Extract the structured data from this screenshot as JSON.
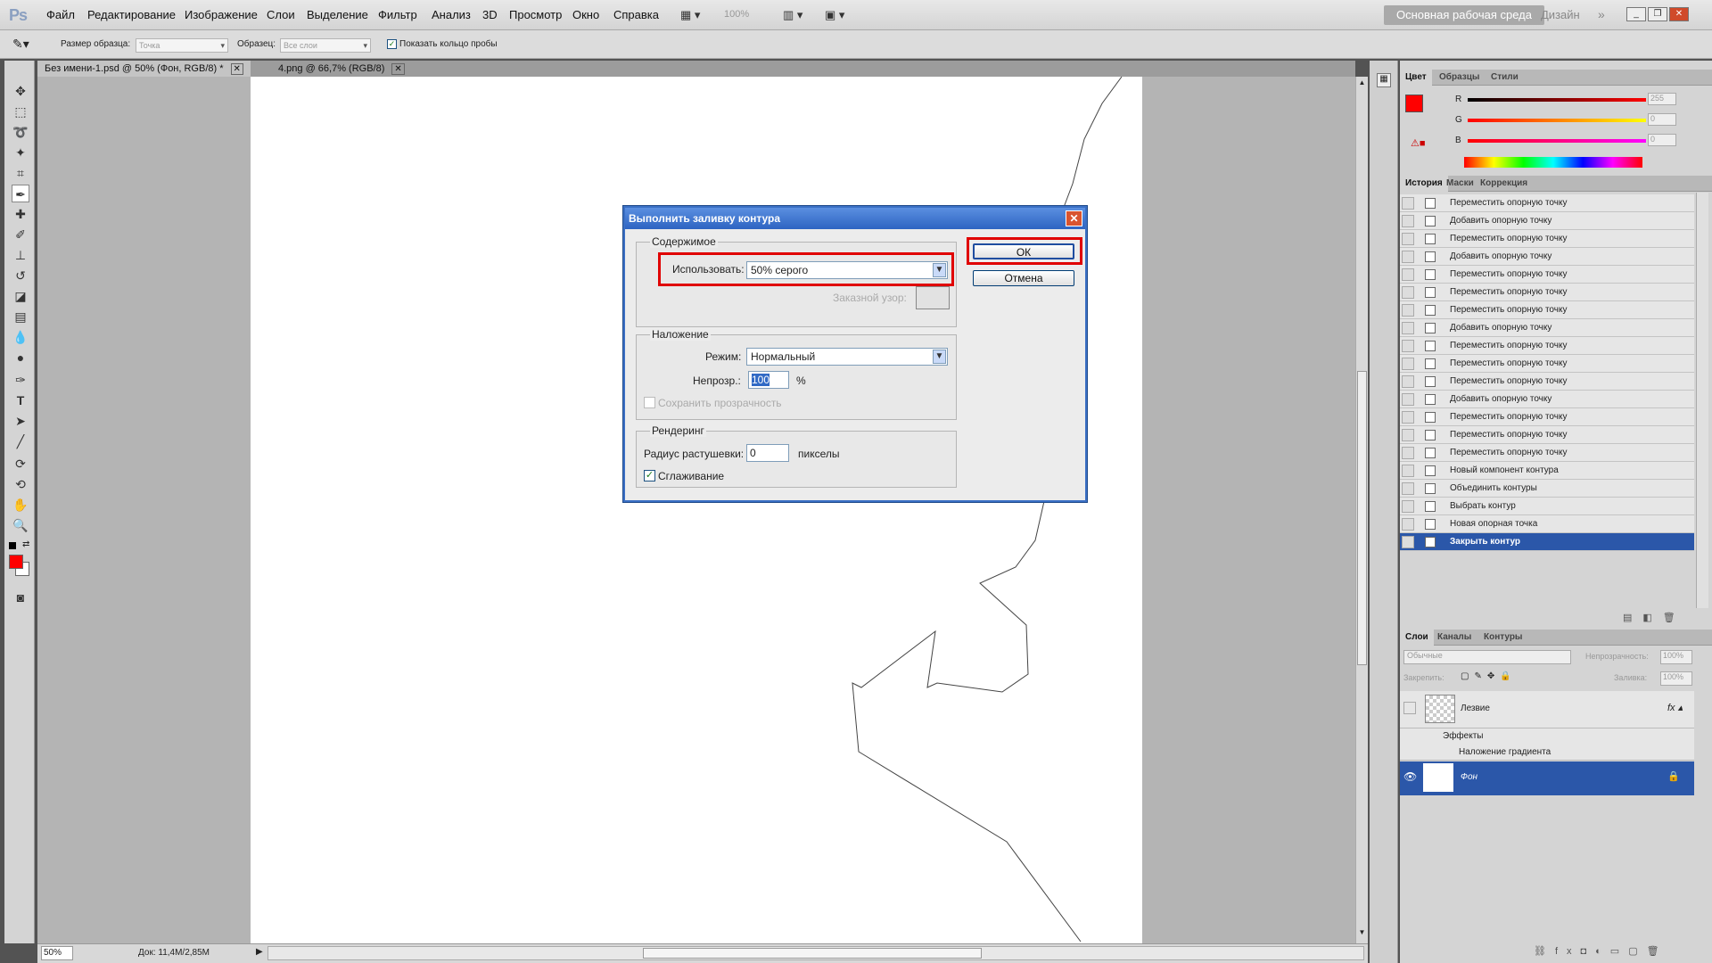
{
  "app": {
    "logo": "Ps",
    "menu": [
      "Файл",
      "Редактирование",
      "Изображение",
      "Слои",
      "Выделение",
      "Фильтр",
      "Анализ",
      "3D",
      "Просмотр",
      "Окно",
      "Справка"
    ],
    "zoom_value": "100%",
    "workspace": "Основная рабочая среда",
    "design": "Дизайн"
  },
  "options": {
    "sample_size_label": "Размер образца:",
    "sample_size_value": "Точка",
    "sample_label": "Образец:",
    "sample_value": "Все слои",
    "show_ring_label": "Показать кольцо пробы"
  },
  "tabs": [
    {
      "label": "Без имени-1.psd @ 50% (Фон, RGB/8) *"
    },
    {
      "label": "4.png @ 66,7% (RGB/8)"
    }
  ],
  "status": {
    "zoom": "50%",
    "doc": "Док: 11,4M/2,85M"
  },
  "color_panel": {
    "tabs": [
      "Цвет",
      "Образцы",
      "Стили"
    ],
    "r_label": "R",
    "g_label": "G",
    "b_label": "B",
    "r_value": "255",
    "g_value": "0",
    "b_value": "0",
    "fg_color": "#ff0000"
  },
  "history_panel": {
    "tabs": [
      "История",
      "Маски",
      "Коррекция"
    ],
    "items": [
      "Переместить опорную точку",
      "Добавить опорную точку",
      "Переместить опорную точку",
      "Добавить опорную точку",
      "Переместить опорную точку",
      "Переместить опорную точку",
      "Переместить опорную точку",
      "Добавить опорную точку",
      "Переместить опорную точку",
      "Переместить опорную точку",
      "Переместить опорную точку",
      "Добавить опорную точку",
      "Переместить опорную точку",
      "Переместить опорную точку",
      "Переместить опорную точку",
      "Новый компонент контура",
      "Объединить контуры",
      "Выбрать контур",
      "Новая опорная точка",
      "Закрыть контур"
    ]
  },
  "layers_panel": {
    "tabs": [
      "Слои",
      "Каналы",
      "Контуры"
    ],
    "blend_mode": "Обычные",
    "opacity_label": "Непрозрачность:",
    "opacity_value": "100%",
    "lock_label": "Закрепить:",
    "fill_label": "Заливка:",
    "fill_value": "100%",
    "layers": [
      {
        "name": "Лезвие"
      },
      {
        "name": "Фон"
      }
    ],
    "effects_label": "Эффекты",
    "effect_name": "Наложение градиента"
  },
  "dialog": {
    "title": "Выполнить заливку контура",
    "content_group": "Содержимое",
    "use_label": "Использовать:",
    "use_value": "50% серого",
    "pattern_label": "Заказной узор:",
    "ok": "ОК",
    "cancel": "Отмена",
    "blend_group": "Наложение",
    "mode_label": "Режим:",
    "mode_value": "Нормальный",
    "opacity_label": "Непрозр.:",
    "opacity_value": "100",
    "percent": "%",
    "preserve_label": "Сохранить прозрачность",
    "render_group": "Рендеринг",
    "feather_label": "Радиус растушевки:",
    "feather_value": "0",
    "pixels": "пикселы",
    "antialias_label": "Сглаживание"
  }
}
